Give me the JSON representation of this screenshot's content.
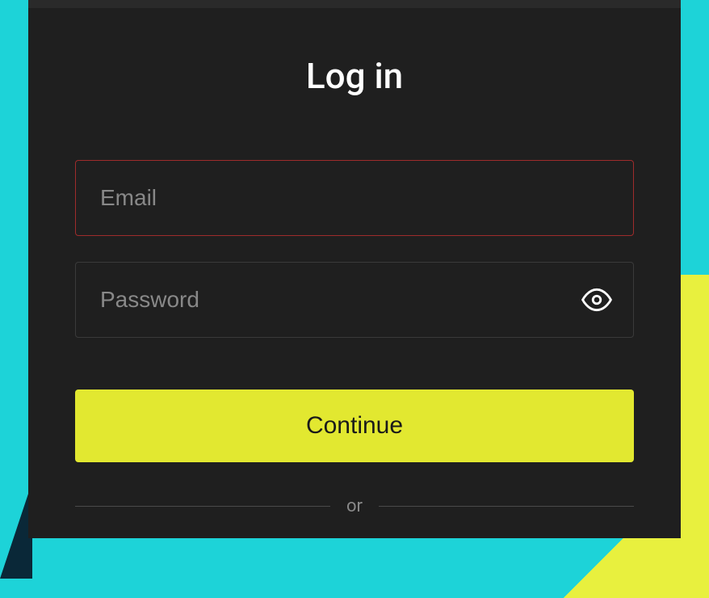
{
  "title": "Log in",
  "email": {
    "placeholder": "Email",
    "value": ""
  },
  "password": {
    "placeholder": "Password",
    "value": ""
  },
  "continue_label": "Continue",
  "divider_text": "or",
  "colors": {
    "accent": "#e2e830",
    "error_border": "#9e2b2b",
    "bg_modal": "#1f1f1f"
  }
}
